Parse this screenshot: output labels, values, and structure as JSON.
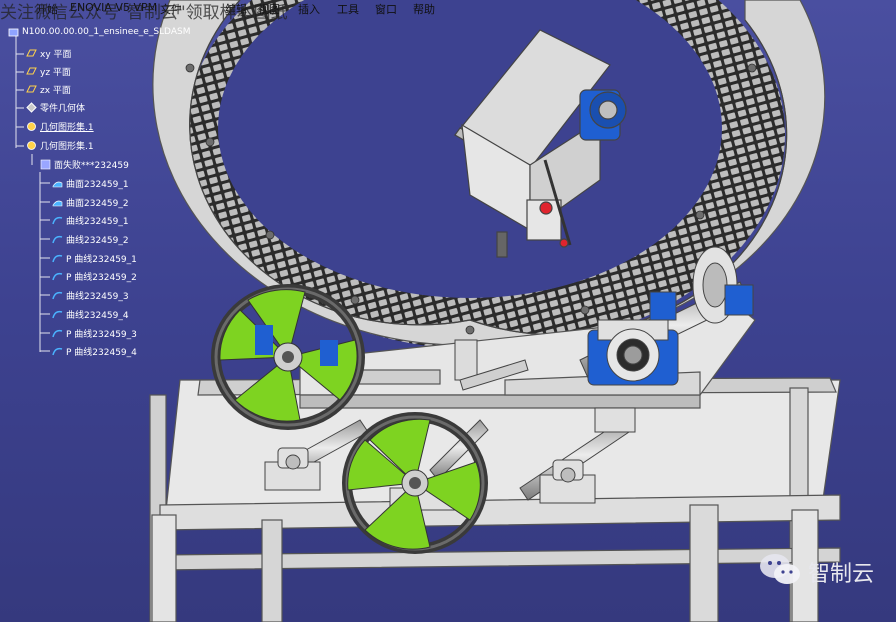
{
  "watermark": "关注微信公众号\"智制云\"领取样本图纸",
  "menu": [
    {
      "label": "开始"
    },
    {
      "label": "ENOVIA V5 VPM"
    },
    {
      "label": "文件"
    },
    {
      "label": "编辑"
    },
    {
      "label": "视图"
    },
    {
      "label": "插入"
    },
    {
      "label": "工具"
    },
    {
      "label": "窗口"
    },
    {
      "label": "帮助"
    }
  ],
  "tree": {
    "root": "N100.00.00.00_1_ensinee_e_SLDASM",
    "items": [
      {
        "label": "xy 平面"
      },
      {
        "label": "yz 平面"
      },
      {
        "label": "zx 平面"
      },
      {
        "label": "零件几何体"
      },
      {
        "label": "几何图形集.1"
      },
      {
        "label": "几何图形集.1"
      },
      {
        "label": "面失败***232459"
      },
      {
        "label": "曲面232459_1"
      },
      {
        "label": "曲面232459_2"
      },
      {
        "label": "曲线232459_1"
      },
      {
        "label": "曲线232459_2"
      },
      {
        "label": "P 曲线232459_1"
      },
      {
        "label": "P 曲线232459_2"
      },
      {
        "label": "曲线232459_3"
      },
      {
        "label": "曲线232459_4"
      },
      {
        "label": "P 曲线232459_3"
      },
      {
        "label": "P 曲线232459_4"
      }
    ]
  },
  "brand": {
    "name": "智制云",
    "icon": "wechat-icon"
  },
  "colors": {
    "background": "#3d4290",
    "frame": "#dcdcdc",
    "handwheel_hub": "#7ed321",
    "bearing_block": "#1f5fd1"
  }
}
